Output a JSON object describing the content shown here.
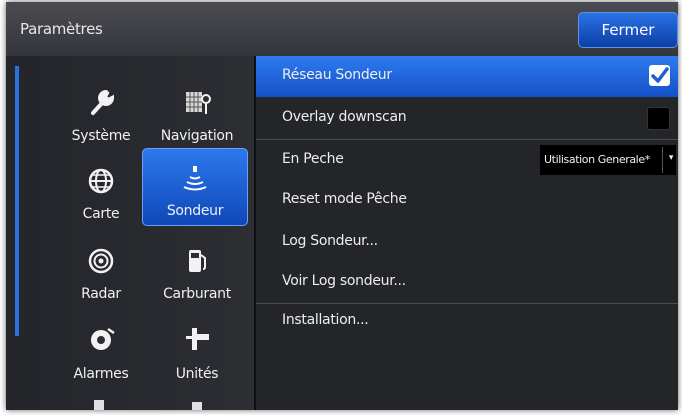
{
  "header": {
    "title": "Paramètres",
    "close_label": "Fermer"
  },
  "sidebar": {
    "items": [
      {
        "label": "Système",
        "icon": "wrench-icon"
      },
      {
        "label": "Navigation",
        "icon": "navigation-chart-icon"
      },
      {
        "label": "Carte",
        "icon": "globe-icon"
      },
      {
        "label": "Sondeur",
        "icon": "sonar-icon",
        "selected": true
      },
      {
        "label": "Radar",
        "icon": "radar-icon"
      },
      {
        "label": "Carburant",
        "icon": "fuel-pump-icon"
      },
      {
        "label": "Alarmes",
        "icon": "alarm-icon"
      },
      {
        "label": "Unités",
        "icon": "units-icon"
      }
    ]
  },
  "settings": {
    "reseau_sondeur": {
      "label": "Réseau Sondeur",
      "checked": true
    },
    "overlay_downscan": {
      "label": "Overlay downscan",
      "checked": false
    },
    "en_peche": {
      "label": "En Peche",
      "value": "Utilisation Generale*"
    },
    "reset_mode": {
      "label": "Reset mode Pêche"
    },
    "log_sondeur": {
      "label": "Log Sondeur..."
    },
    "voir_log": {
      "label": "Voir Log sondeur..."
    },
    "installation": {
      "label": "Installation..."
    }
  },
  "colors": {
    "accent": "#1f5fd6",
    "background": "#232529",
    "text": "#eeeeee"
  }
}
